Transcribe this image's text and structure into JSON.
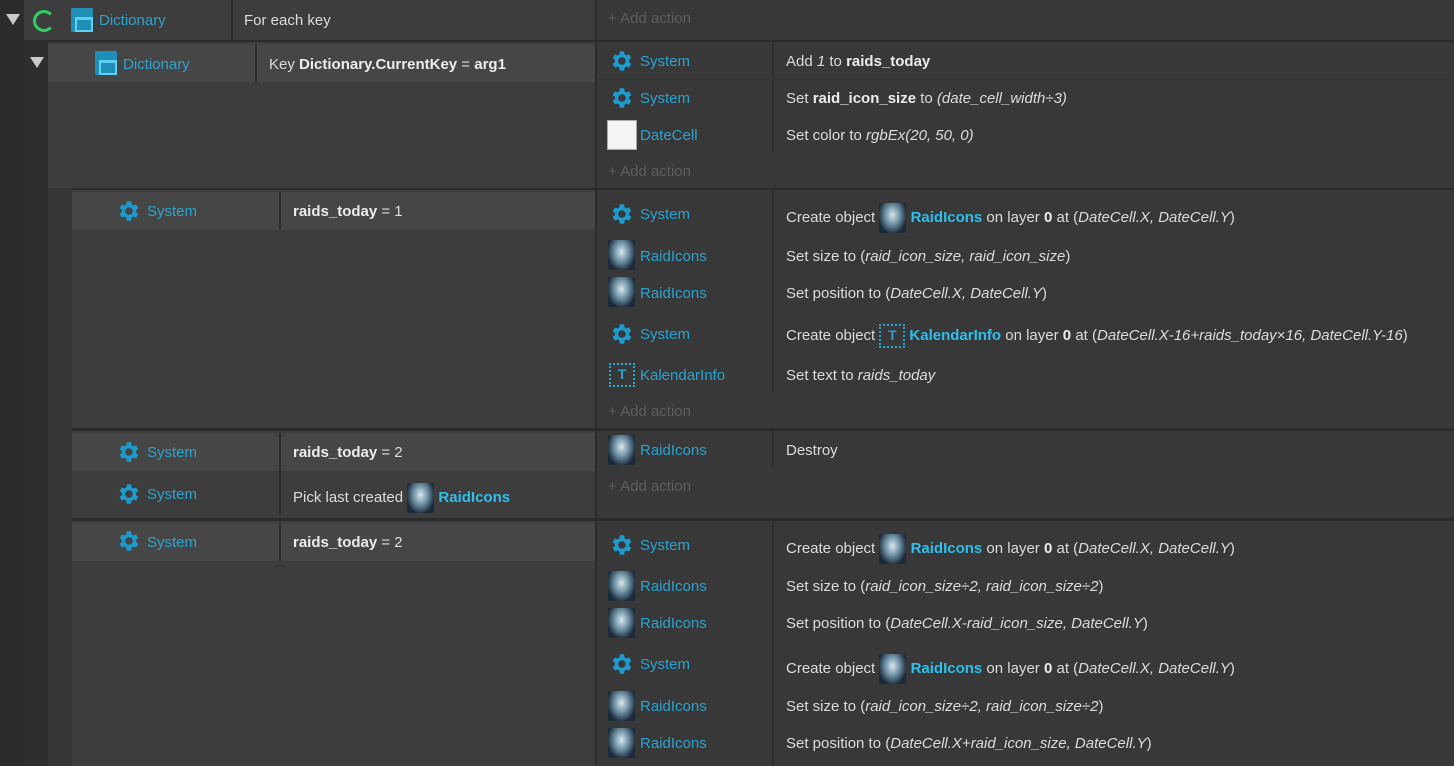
{
  "event1": {
    "object": "Dictionary",
    "condition": "For each key",
    "add_action": "Add action"
  },
  "event2": {
    "object": "Dictionary",
    "condition_prefix": "Key",
    "condition_key": "Dictionary.CurrentKey",
    "condition_op": "=",
    "condition_value": "arg1",
    "actions": [
      {
        "object": "System",
        "icon": "gear-icon",
        "parts": [
          "Add ",
          "1",
          " to ",
          "raids_today"
        ]
      },
      {
        "object": "System",
        "icon": "gear-icon",
        "parts": [
          "Set ",
          "raid_icon_size",
          " to ",
          "(date_cell_width÷3)"
        ]
      },
      {
        "object": "DateCell",
        "icon": "white-square-icon",
        "parts": [
          "Set color to ",
          "rgbEx(20, 50, 0)"
        ]
      }
    ],
    "add_action": "Add action"
  },
  "event3": {
    "cond_object": "System",
    "cond_var": "raids_today",
    "cond_rest": "= 1",
    "actions": [
      {
        "object": "System",
        "icon": "gear-icon",
        "text": "Create object",
        "target": "RaidIcons",
        "layer_pre": "on layer",
        "layer": "0",
        "at": "at (",
        "args": "DateCell.X, DateCell.Y",
        "close": ")"
      },
      {
        "object": "RaidIcons",
        "icon": "dragon-icon",
        "text": "Set size to (",
        "args": "raid_icon_size, raid_icon_size",
        "close": ")"
      },
      {
        "object": "RaidIcons",
        "icon": "dragon-icon",
        "text": "Set position to (",
        "args": "DateCell.X, DateCell.Y",
        "close": ")"
      },
      {
        "object": "System",
        "icon": "gear-icon",
        "text": "Create object",
        "target": "KalendarInfo",
        "layer_pre": "on layer",
        "layer": "0",
        "at": "at (",
        "args": "DateCell.X-16+raids_today×16, DateCell.Y-16",
        "close": ")"
      },
      {
        "object": "KalendarInfo",
        "icon": "text-object-icon",
        "text": "Set text to",
        "args": "raids_today"
      }
    ],
    "add_action": "Add action"
  },
  "event4": {
    "cond1_object": "System",
    "cond1_var": "raids_today",
    "cond1_rest": "= 2",
    "cond2_object": "System",
    "cond2_text": "Pick last created",
    "cond2_target": "RaidIcons",
    "action_object": "RaidIcons",
    "action_text": "Destroy",
    "add_action": "Add action"
  },
  "event5": {
    "cond_object": "System",
    "cond_var": "raids_today",
    "cond_rest": "= 2",
    "actions": [
      {
        "object": "System",
        "text": "Create object",
        "target": "RaidIcons",
        "layer_pre": "on layer",
        "layer": "0",
        "at": "at (",
        "args": "DateCell.X, DateCell.Y",
        "close": ")"
      },
      {
        "object": "RaidIcons",
        "text": "Set size to (",
        "args": "raid_icon_size÷2, raid_icon_size÷2",
        "close": ")"
      },
      {
        "object": "RaidIcons",
        "text": "Set position to (",
        "args": "DateCell.X-raid_icon_size, DateCell.Y",
        "close": ")"
      },
      {
        "object": "System",
        "text": "Create object",
        "target": "RaidIcons",
        "layer_pre": "on layer",
        "layer": "0",
        "at": "at (",
        "args": "DateCell.X, DateCell.Y",
        "close": ")"
      },
      {
        "object": "RaidIcons",
        "text": "Set size to (",
        "args": "raid_icon_size÷2, raid_icon_size÷2",
        "close": ")"
      },
      {
        "object": "RaidIcons",
        "text": "Set position to (",
        "args": "DateCell.X+raid_icon_size, DateCell.Y",
        "close": ")"
      }
    ]
  },
  "colors": {
    "object_name": "#2aa3d0",
    "keyword": "#2ec0ec",
    "loop_icon": "#2fcf62",
    "background": "#2b2b2b"
  }
}
